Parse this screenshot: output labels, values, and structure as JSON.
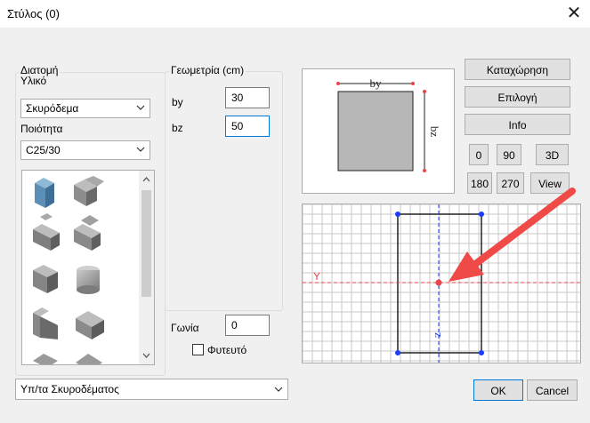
{
  "window": {
    "title": "Στύλος (0)",
    "close_symbol": "✕"
  },
  "section": {
    "group_label": "Διατομή",
    "material_label": "Υλικό",
    "material_value": "Σκυρόδεμα",
    "quality_label": "Ποιότητα",
    "quality_value": "C25/30"
  },
  "geometry": {
    "group_label": "Γεωμετρία (cm)",
    "by_label": "by",
    "by_value": "30",
    "bz_label": "bz",
    "bz_value": "50"
  },
  "angle": {
    "label": "Γωνία",
    "value": "0"
  },
  "buried": {
    "label": "Φυτευτό",
    "checked": false
  },
  "bottom_combo": {
    "value": "Υπ/τα Σκυροδέματος"
  },
  "preview": {
    "by_label": "by",
    "bz_label": "bz"
  },
  "plan": {
    "y_label": "Y",
    "z_label": "z"
  },
  "side_buttons": {
    "register": "Καταχώρηση",
    "select": "Επιλογή",
    "info": "Info",
    "v0": "0",
    "v90": "90",
    "v3d": "3D",
    "v180": "180",
    "v270": "270",
    "view": "View"
  },
  "dialog_buttons": {
    "ok": "OK",
    "cancel": "Cancel"
  },
  "shapes": [
    {
      "name": "rectangular-prism"
    },
    {
      "name": "l-shape"
    },
    {
      "name": "t-shape"
    },
    {
      "name": "c-shape"
    },
    {
      "name": "u-shape"
    },
    {
      "name": "cylinder"
    },
    {
      "name": "l-column"
    },
    {
      "name": "t-column"
    },
    {
      "name": "partial-l"
    },
    {
      "name": "partial-t"
    }
  ],
  "colors": {
    "accent": "#0078d7",
    "axis_red": "#e8444a",
    "axis_blue": "#1a3cff",
    "arrow": "#ef4a48",
    "section_fill": "#b7b7b7"
  }
}
